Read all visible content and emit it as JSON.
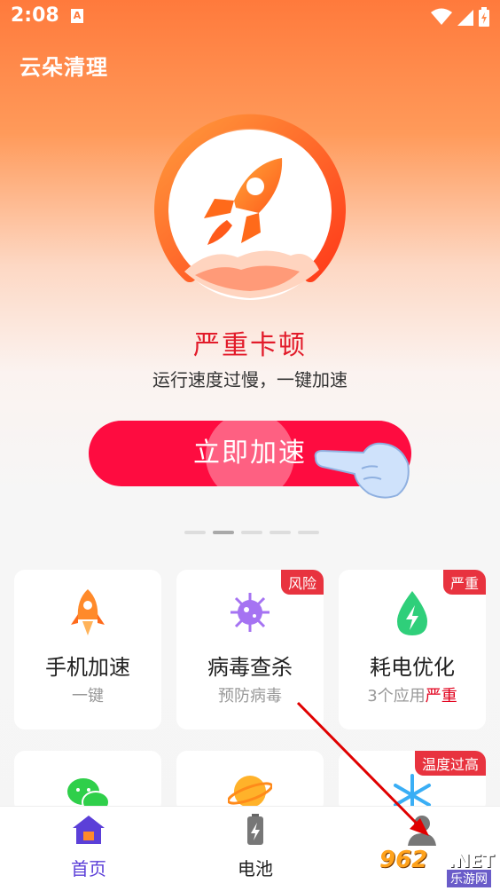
{
  "status_bar": {
    "time": "2:08",
    "notif_glyph": "A"
  },
  "app": {
    "title": "云朵清理"
  },
  "hero": {
    "status_title": "严重卡顿",
    "status_subtitle": "运行速度过慢，一键加速",
    "cta_label": "立即加速"
  },
  "pager": {
    "count": 5,
    "active_index": 1
  },
  "cards": [
    {
      "title": "手机加速",
      "sub": "一键",
      "sub_warn": "",
      "badge": "",
      "icon": "rocket-icon"
    },
    {
      "title": "病毒查杀",
      "sub": "预防病毒",
      "sub_warn": "",
      "badge": "风险",
      "icon": "virus-icon"
    },
    {
      "title": "耗电优化",
      "sub": "3个应用",
      "sub_warn": "严重",
      "badge": "严重",
      "icon": "battery-drop-icon"
    },
    {
      "title": "",
      "sub": "",
      "sub_warn": "",
      "badge": "",
      "icon": "wechat-icon"
    },
    {
      "title": "",
      "sub": "",
      "sub_warn": "",
      "badge": "",
      "icon": "planet-icon"
    },
    {
      "title": "",
      "sub": "",
      "sub_warn": "",
      "badge": "温度过高",
      "icon": "snowflake-icon"
    }
  ],
  "tabs": [
    {
      "label": "首页",
      "icon": "home-icon",
      "active": true
    },
    {
      "label": "电池",
      "icon": "battery-icon",
      "active": false
    },
    {
      "label": "",
      "icon": "profile-icon",
      "active": false
    }
  ],
  "watermark": {
    "brand": "962",
    "net": ".NET",
    "cn": "乐游网"
  },
  "colors": {
    "accent": "#fe0c40",
    "primary_tab": "#5b3fd8",
    "warning": "#e2001c"
  }
}
